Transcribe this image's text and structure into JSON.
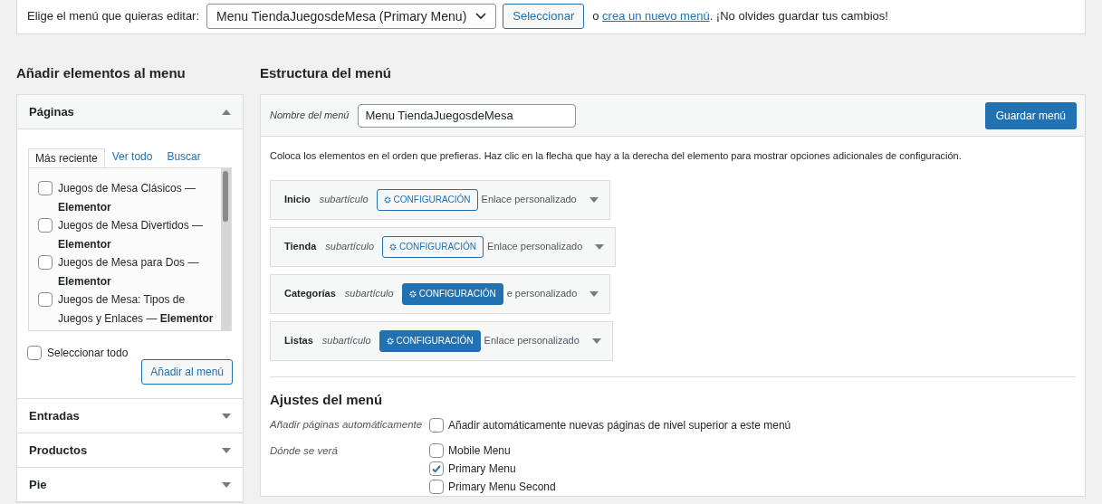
{
  "menu_select": {
    "label": "Elige el menú que quieras editar:",
    "value": "Menu TiendaJuegosdeMesa (Primary Menu)",
    "button": "Seleccionar",
    "before_link": "o",
    "link": "crea un nuevo menú",
    "after_link": ". ¡No olvides guardar tus cambios!"
  },
  "add_items": {
    "title": "Añadir elementos al menu",
    "panels": [
      {
        "title": "Páginas",
        "expanded": true
      },
      {
        "title": "Entradas",
        "expanded": false
      },
      {
        "title": "Productos",
        "expanded": false
      },
      {
        "title": "Pie",
        "expanded": false
      }
    ],
    "tabs": [
      {
        "label": "Más reciente",
        "selected": true
      },
      {
        "label": "Ver todo",
        "selected": false
      },
      {
        "label": "Buscar",
        "selected": false
      }
    ],
    "pages": [
      {
        "title": "Juegos de Mesa Clásicos —",
        "suffix": "Elementor",
        "checked": false
      },
      {
        "title": "Juegos de Mesa Divertidos —",
        "suffix": "Elementor",
        "checked": false
      },
      {
        "title": "Juegos de Mesa para Dos —",
        "suffix": "Elementor",
        "checked": false
      },
      {
        "title": "Juegos de Mesa: Tipos de Juegos y Enlaces —",
        "suffix": "Elementor",
        "checked": false
      }
    ],
    "select_all": {
      "label": "Seleccionar todo",
      "checked": false
    },
    "add_button": "Añadir al menú"
  },
  "structure": {
    "title": "Estructura del menú",
    "name_label": "Nombre del menú",
    "name_value": "Menu TiendaJuegosdeMesa",
    "save_button": "Guardar menú",
    "instructions": "Coloca los elementos en el orden que prefieras. Haz clic en la flecha que hay a la derecha del elemento para mostrar opciones adicionales de configuración.",
    "items": [
      {
        "label": "Inicio",
        "sub": "subartículo",
        "button": "CONFIGURACIÓN",
        "highlighted": false,
        "type": "Enlace personalizado"
      },
      {
        "label": "Tienda",
        "sub": "subartículo",
        "button": "CONFIGURACIÓN",
        "highlighted": false,
        "type": "Enlace personalizado"
      },
      {
        "label": "Categorías",
        "sub": "subartículo",
        "button": "CONFIGURACIÓN",
        "highlighted": true,
        "type": "e personalizado"
      },
      {
        "label": "Listas",
        "sub": "subartículo",
        "button": "CONFIGURACIÓN",
        "highlighted": true,
        "type": "Enlace personalizado"
      }
    ],
    "settings": {
      "title": "Ajustes del menú",
      "auto_label": "Añadir páginas automáticamente",
      "auto_option": {
        "label": "Añadir automáticamente nuevas páginas de nivel superior a este menú",
        "checked": false
      },
      "locations_label": "Dónde se verá",
      "locations": [
        {
          "label": "Mobile Menu",
          "checked": false
        },
        {
          "label": "Primary Menu",
          "checked": true
        },
        {
          "label": "Primary Menu Second",
          "checked": false
        }
      ]
    }
  }
}
